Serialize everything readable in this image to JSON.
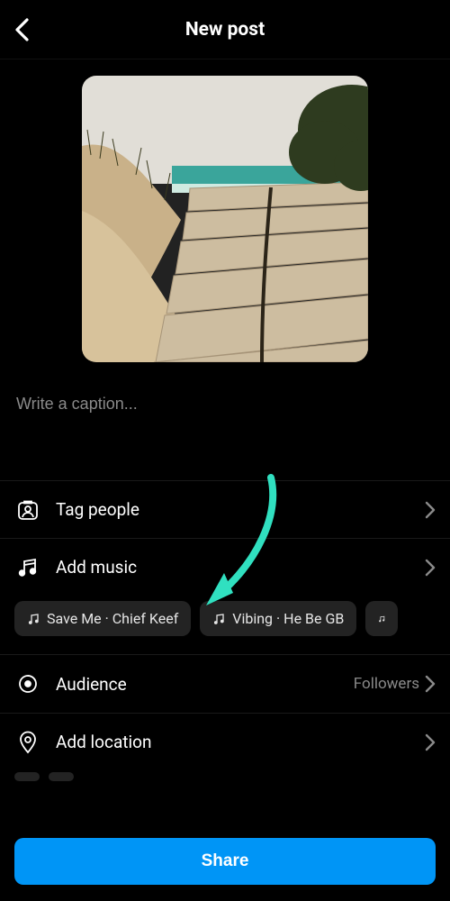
{
  "header": {
    "title": "New post"
  },
  "caption": {
    "placeholder": "Write a caption..."
  },
  "rows": {
    "tag_people": {
      "label": "Tag people"
    },
    "add_music": {
      "label": "Add music"
    },
    "audience": {
      "label": "Audience",
      "value": "Followers"
    },
    "add_location": {
      "label": "Add location"
    }
  },
  "music_chips": [
    {
      "label": "Save Me · Chief Keef"
    },
    {
      "label": "Vibing · He Be GB"
    }
  ],
  "footer": {
    "share_label": "Share"
  },
  "colors": {
    "accent": "#0095f6",
    "arrow": "#30e0c0"
  }
}
